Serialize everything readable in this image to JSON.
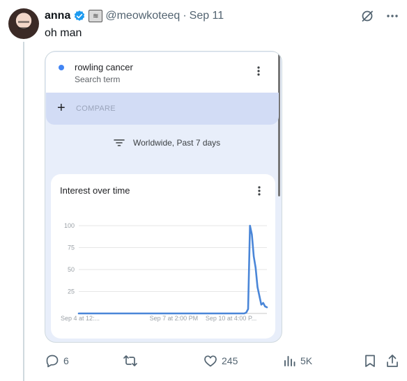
{
  "tweet": {
    "author_name": "anna",
    "handle": "@meowkoteeq",
    "separator": "·",
    "date": "Sep 11",
    "text": "oh man"
  },
  "embed": {
    "search_term": "rowling cancer",
    "search_term_type": "Search term",
    "compare_label": "COMPARE",
    "filter_label": "Worldwide, Past 7 days",
    "chart_title": "Interest over time"
  },
  "chart_data": {
    "type": "line",
    "title": "Interest over time",
    "xlabel": "",
    "ylabel": "",
    "ylim": [
      0,
      100
    ],
    "yticks": [
      25,
      50,
      75,
      100
    ],
    "xtick_labels": [
      "Sep 4 at 12:...",
      "Sep 7 at 2:00 PM",
      "Sep 10 at 4:00 P..."
    ],
    "grid": true,
    "series_color": "#4a86d8",
    "x_range": [
      0,
      100
    ],
    "series": [
      {
        "x": [
          0,
          10,
          20,
          30,
          40,
          50,
          60,
          70,
          80,
          84,
          86,
          88,
          89,
          90,
          91,
          92,
          93,
          94,
          95,
          96,
          97,
          98,
          99,
          100
        ],
        "values": [
          0,
          0,
          0,
          0,
          0,
          0,
          0,
          0,
          0,
          0,
          0,
          0,
          1,
          5,
          100,
          90,
          65,
          52,
          30,
          20,
          10,
          12,
          8,
          7
        ]
      }
    ]
  },
  "actions": {
    "replies": "6",
    "likes": "245",
    "views": "5K"
  },
  "colors": {
    "accent": "#1d9bf0",
    "trends_blue": "#4285f4"
  }
}
